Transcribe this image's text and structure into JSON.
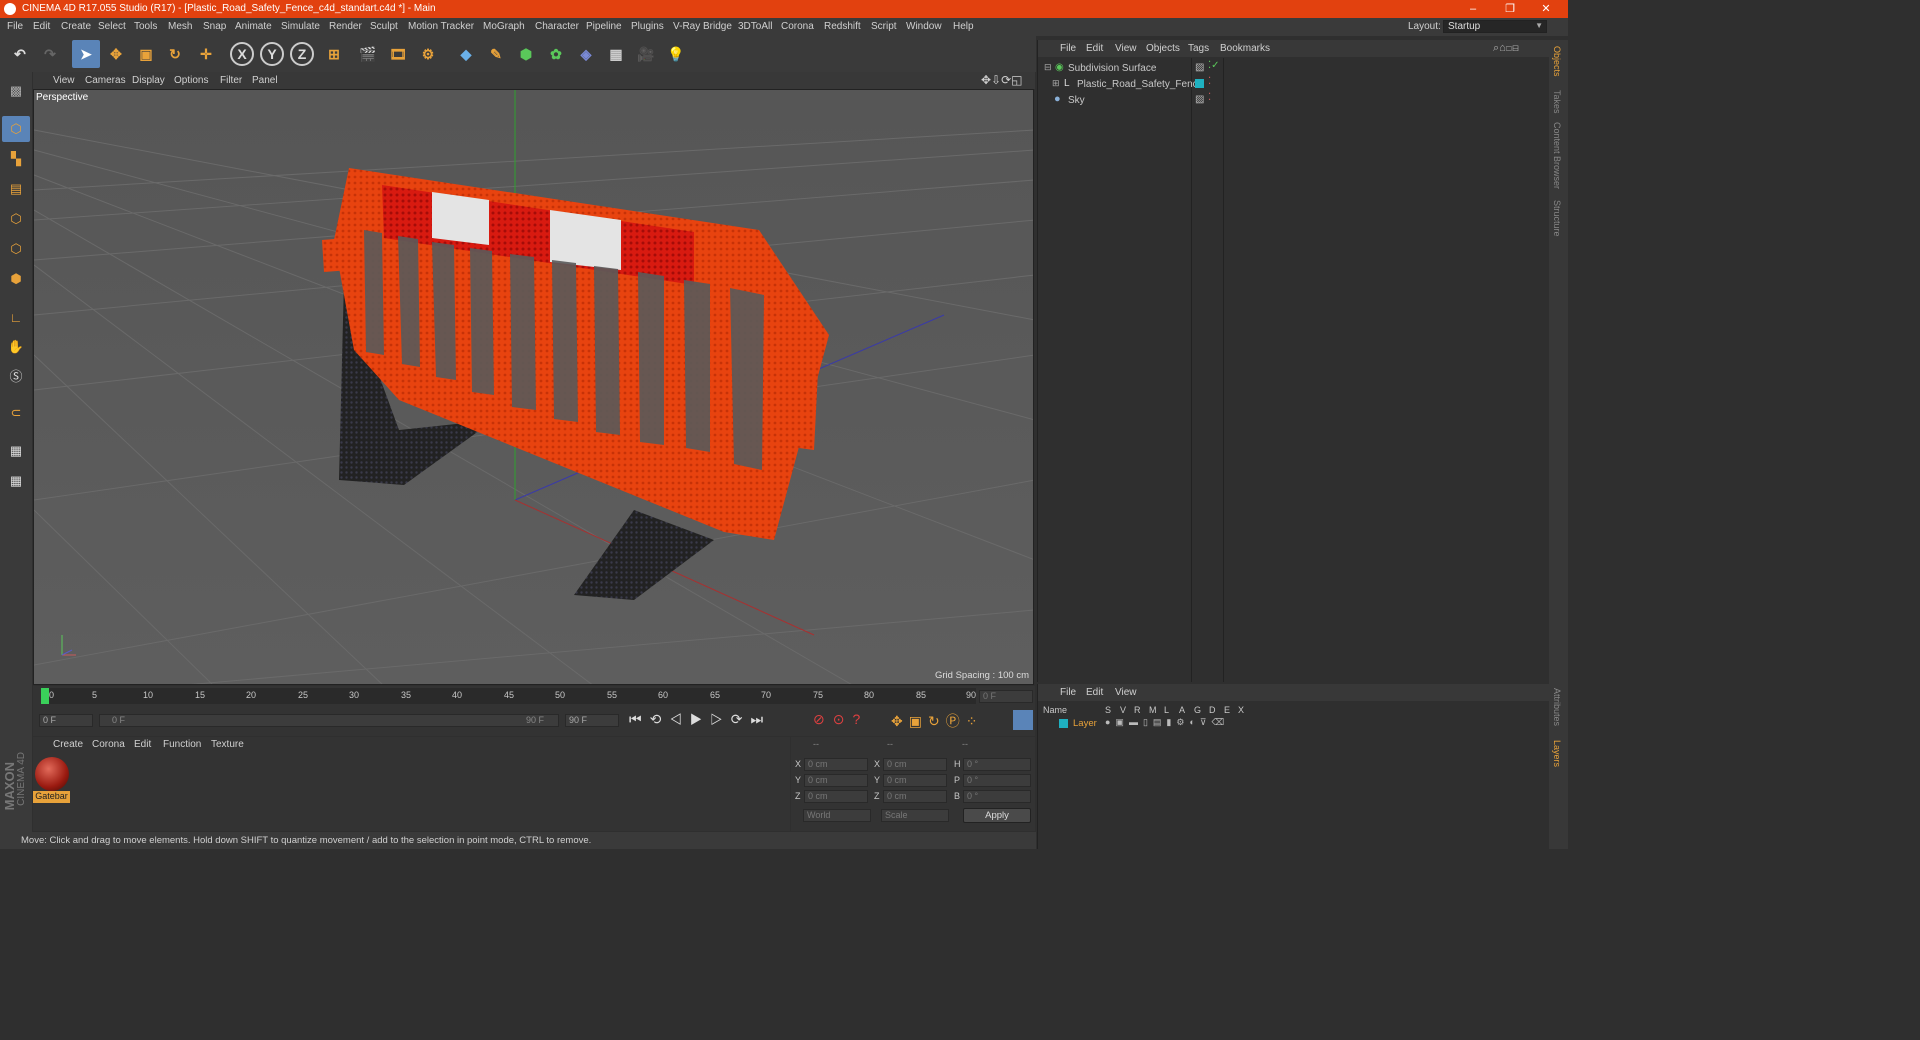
{
  "window": {
    "title": "CINEMA 4D R17.055 Studio (R17) - [Plastic_Road_Safety_Fence_c4d_standart.c4d *] - Main",
    "minimize": "–",
    "maximize": "❐",
    "close": "✕"
  },
  "menu": [
    "File",
    "Edit",
    "Create",
    "Select",
    "Tools",
    "Mesh",
    "Snap",
    "Animate",
    "Simulate",
    "Render",
    "Sculpt",
    "Motion Tracker",
    "MoGraph",
    "Character",
    "Pipeline",
    "Plugins",
    "V-Ray Bridge",
    "3DToAll",
    "Corona",
    "Redshift",
    "Script",
    "Window",
    "Help"
  ],
  "layout": {
    "label": "Layout:",
    "value": "Startup"
  },
  "toolbar": {
    "x_label": "X",
    "y_label": "Y",
    "z_label": "Z"
  },
  "viewport": {
    "menu": [
      "View",
      "Cameras",
      "Display",
      "Options",
      "Filter",
      "Panel"
    ],
    "camera_label": "Perspective",
    "grid_spacing": "Grid Spacing : 100 cm"
  },
  "timeline": {
    "ticks": [
      "0",
      "5",
      "10",
      "15",
      "20",
      "25",
      "30",
      "35",
      "40",
      "45",
      "50",
      "55",
      "60",
      "65",
      "70",
      "75",
      "80",
      "85",
      "90"
    ],
    "current_frame": "0 F",
    "start_frame": "0 F",
    "range_start": "0 F",
    "range_end": "90 F",
    "end_frame": "90 F"
  },
  "material_panel": {
    "menu": [
      "Create",
      "Corona",
      "Edit",
      "Function",
      "Texture"
    ],
    "material_name": "Gatebar"
  },
  "coordinates": {
    "headers": [
      "--",
      "--",
      "--"
    ],
    "rows": [
      {
        "a": "X",
        "v1": "0 cm",
        "b": "X",
        "v2": "0 cm",
        "c": "H",
        "v3": "0 °"
      },
      {
        "a": "Y",
        "v1": "0 cm",
        "b": "Y",
        "v2": "0 cm",
        "c": "P",
        "v3": "0 °"
      },
      {
        "a": "Z",
        "v1": "0 cm",
        "b": "Z",
        "v2": "0 cm",
        "c": "B",
        "v3": "0 °"
      }
    ],
    "world": "World",
    "scale": "Scale",
    "apply": "Apply"
  },
  "status": "Move: Click and drag to move elements. Hold down SHIFT to quantize movement / add to the selection in point mode, CTRL to remove.",
  "objects_panel": {
    "menu": [
      "File",
      "Edit",
      "View",
      "Objects",
      "Tags",
      "Bookmarks"
    ],
    "items": [
      "Subdivision Surface",
      "Plastic_Road_Safety_Fence",
      "Sky"
    ]
  },
  "layers_panel": {
    "menu": [
      "File",
      "Edit",
      "View"
    ],
    "columns": [
      "Name",
      "S",
      "V",
      "R",
      "M",
      "L",
      "A",
      "G",
      "D",
      "E",
      "X"
    ],
    "layer_name": "Layer"
  },
  "right_tabs": [
    "Objects",
    "Takes",
    "Content Browser",
    "Structure"
  ],
  "right_tabs_bottom": [
    "Attributes",
    "Layers"
  ],
  "brand": [
    "MAXON",
    "CINEMA 4D"
  ],
  "colors": {
    "accent": "#e2410f",
    "fence": "#e8430f",
    "layer": "#1fb0c0"
  }
}
